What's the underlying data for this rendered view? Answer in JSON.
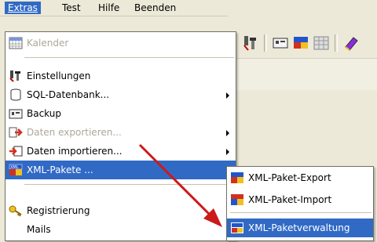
{
  "menubar": {
    "items": [
      {
        "label": "Extras"
      },
      {
        "label": "Test"
      },
      {
        "label": "Hilfe"
      },
      {
        "label": "Beenden"
      }
    ]
  },
  "extras_menu": {
    "items": [
      {
        "label": "Kalender",
        "icon": "calendar-icon",
        "disabled": true
      },
      {
        "label": "Einstellungen",
        "icon": "settings-tools-icon"
      },
      {
        "label": "SQL-Datenbank...",
        "icon": "database-icon",
        "submenu": true
      },
      {
        "label": "Backup",
        "icon": "backup-icon"
      },
      {
        "label": "Daten exportieren...",
        "icon": "export-icon",
        "disabled": true,
        "submenu": true
      },
      {
        "label": "Daten importieren...",
        "icon": "import-icon",
        "submenu": true
      },
      {
        "label": "XML-Pakete ...",
        "icon": "xml-icon",
        "submenu": true,
        "highlighted": true
      },
      {
        "label": "Registrierung",
        "icon": "key-icon"
      },
      {
        "label": "Mails"
      }
    ]
  },
  "xml_submenu": {
    "items": [
      {
        "label": "XML-Paket-Export",
        "icon": "xml-export-icon"
      },
      {
        "label": "XML-Paket-Import",
        "icon": "xml-import-icon"
      },
      {
        "label": "XML-Paketverwaltung",
        "icon": "xml-manage-icon",
        "highlighted": true
      }
    ]
  },
  "colors": {
    "highlight": "#316ac5",
    "menu_bg": "#ffffff",
    "window_bg": "#ece9d8",
    "annotation_arrow": "#cc1a1a"
  }
}
